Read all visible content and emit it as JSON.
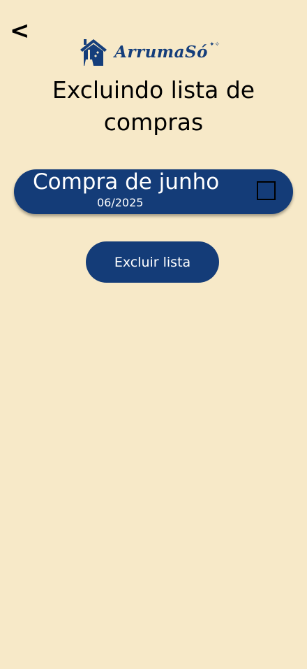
{
  "header": {
    "back_label": "<",
    "logo_text": "ArrumaSó",
    "logo_stars": "✦✧"
  },
  "page": {
    "title": "Excluindo lista de compras"
  },
  "list_item": {
    "name": "Compra de junho",
    "date": "06/2025",
    "checked": false
  },
  "actions": {
    "delete_label": "Excluir lista"
  },
  "colors": {
    "background": "#f7e9c8",
    "primary": "#143c78",
    "text": "#000000"
  }
}
